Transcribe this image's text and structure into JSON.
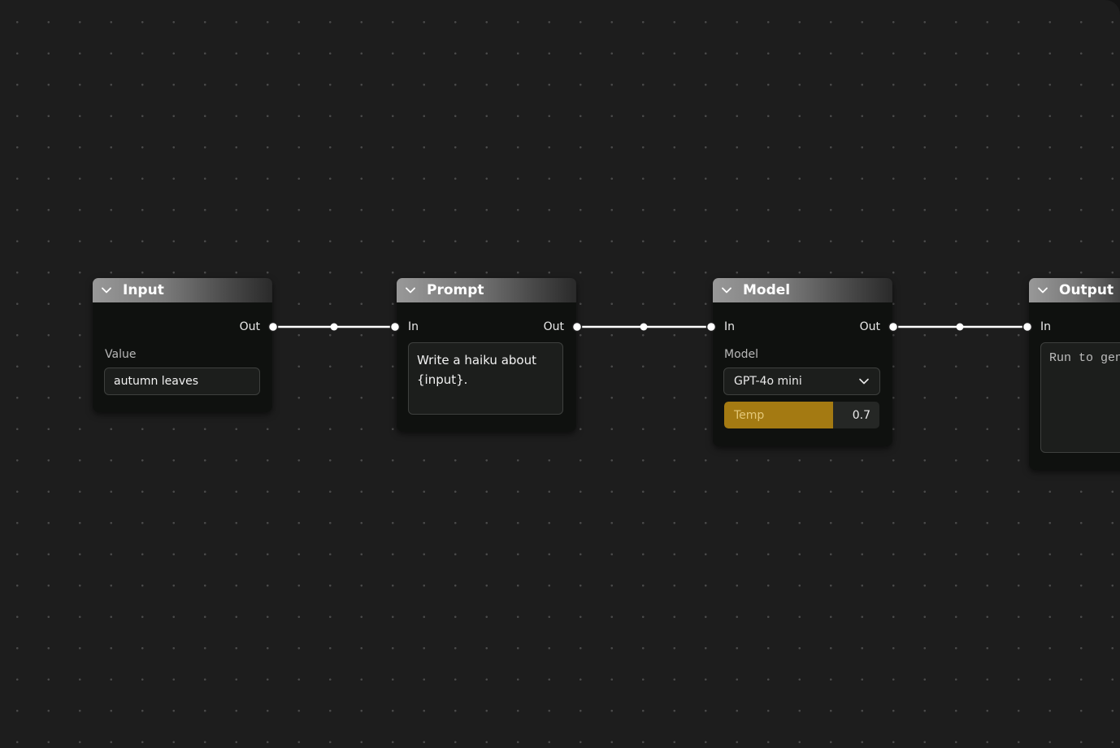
{
  "colors": {
    "canvas": "#1d1d1d",
    "node_body": "#0f110f",
    "wire": "#ffffff",
    "slider_fill": "#a47a12",
    "slider_label": "#e4c878"
  },
  "nodes": {
    "input": {
      "title": "Input",
      "out_label": "Out",
      "value_label": "Value",
      "value": "autumn leaves"
    },
    "prompt": {
      "title": "Prompt",
      "in_label": "In",
      "out_label": "Out",
      "template": "Write a haiku about {input}."
    },
    "model": {
      "title": "Model",
      "in_label": "In",
      "out_label": "Out",
      "model_label": "Model",
      "model_selected": "GPT-4o mini",
      "temp_label": "Temp",
      "temp_value": "0.7",
      "temp_fill_fraction": 0.7
    },
    "output": {
      "title": "Output",
      "in_label": "In",
      "placeholder": "Run to generate…"
    }
  },
  "icons": {
    "header_toggle": "chevron-down-icon",
    "select_toggle": "chevron-down-icon"
  }
}
